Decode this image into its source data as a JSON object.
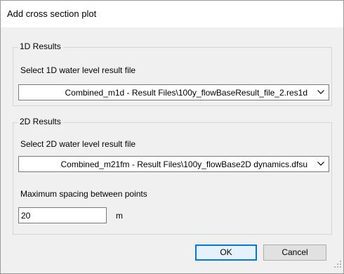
{
  "dialog": {
    "title": "Add cross section plot"
  },
  "results_1d": {
    "group_label": "1D Results",
    "select_label": "Select 1D water level result file",
    "selected_file": "Combined_m1d - Result Files\\100y_flowBaseResult_file_2.res1d"
  },
  "results_2d": {
    "group_label": "2D Results",
    "select_label": "Select 2D water level result file",
    "selected_file": "Combined_m21fm - Result Files\\100y_flowBase2D dynamics.dfsu",
    "spacing_label": "Maximum spacing between points",
    "spacing_value": "20",
    "spacing_unit": "m"
  },
  "buttons": {
    "ok_label": "OK",
    "cancel_label": "Cancel"
  },
  "icons": {
    "dropdown": "chevron-down-icon",
    "resize": "resize-grip-icon"
  },
  "colors": {
    "dialog_background": "#f0f0f0",
    "title_background": "#ffffff",
    "default_button_border": "#0078d7"
  }
}
